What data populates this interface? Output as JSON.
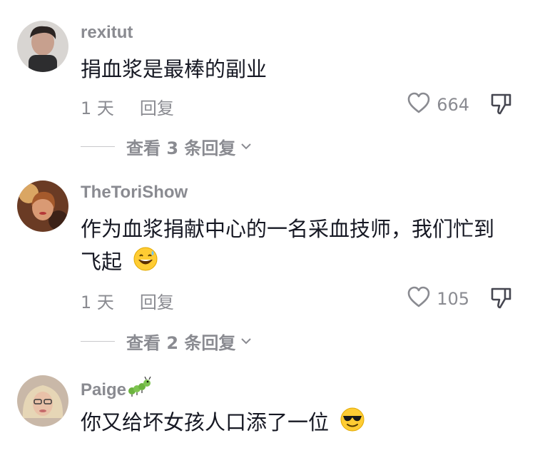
{
  "comments": [
    {
      "username": "rexitut",
      "text": "捐血浆是最棒的副业",
      "time": "1 天",
      "reply_label": "回复",
      "likes": "664",
      "view_replies": "查看 3 条回复"
    },
    {
      "username": "TheToriShow",
      "text_line1": "作为血浆捐献中心的一名采血技师，我们忙到",
      "text_line2": "飞起",
      "emoji": "grinning-face-with-sweat",
      "time": "1 天",
      "reply_label": "回复",
      "likes": "105",
      "view_replies": "查看 2 条回复"
    },
    {
      "username": "Paige",
      "username_emoji": "bug",
      "text": "你又给坏女孩人口添了一位",
      "emoji": "smiling-face-with-sunglasses"
    }
  ],
  "colors": {
    "primary_text": "#161823",
    "secondary_text": "#8a8b91",
    "emoji_yellow": "#ffcc33"
  }
}
